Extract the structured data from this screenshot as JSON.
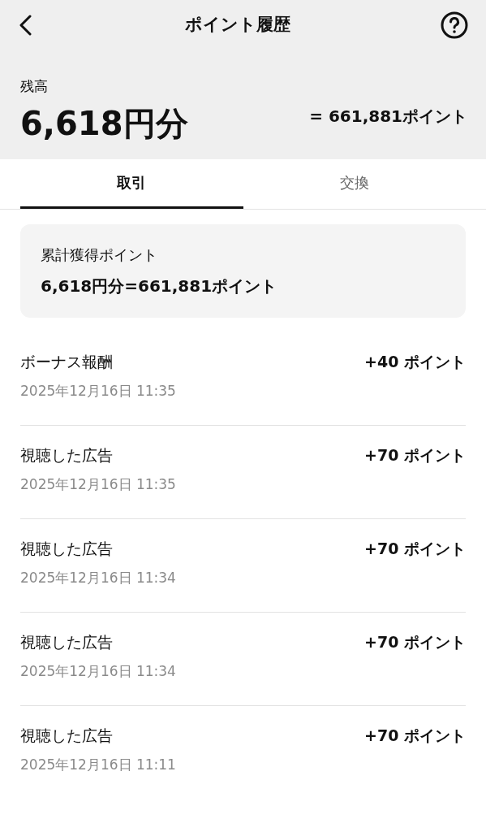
{
  "header": {
    "title": "ポイント履歴"
  },
  "balance": {
    "label": "残高",
    "amount": "6,618円分",
    "points": "= 661,881ポイント"
  },
  "tabs": [
    {
      "label": "取引",
      "selected": true
    },
    {
      "label": "交換",
      "selected": false
    }
  ],
  "summary": {
    "label": "累計獲得ポイント",
    "value": "6,618円分=661,881ポイント"
  },
  "transactions": [
    {
      "title": "ボーナス報酬",
      "time": "2025年12月16日 11:35",
      "points": "+40 ポイント"
    },
    {
      "title": "視聴した広告",
      "time": "2025年12月16日 11:35",
      "points": "+70 ポイント"
    },
    {
      "title": "視聴した広告",
      "time": "2025年12月16日 11:34",
      "points": "+70 ポイント"
    },
    {
      "title": "視聴した広告",
      "time": "2025年12月16日 11:34",
      "points": "+70 ポイント"
    },
    {
      "title": "視聴した広告",
      "time": "2025年12月16日 11:11",
      "points": "+70 ポイント"
    }
  ]
}
